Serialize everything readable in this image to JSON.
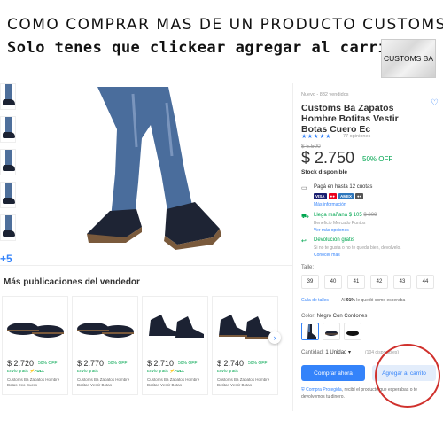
{
  "header": {
    "line1": "COMO COMPRAR MAS DE UN PRODUCTO CUSTOMS",
    "line2": "Solo tenes que clickear agregar al carrito",
    "logo_text": "CUSTOMS BA"
  },
  "gallery": {
    "more_label": "+5"
  },
  "seller_section": {
    "title": "Más publicaciones del vendedor",
    "cards": [
      {
        "price": "$ 2.720",
        "off": "50% OFF",
        "ship": "Envío gratis",
        "full": "⚡FULL",
        "title": "Customs Ba Zapatos Hombre Botas Eco Cuero"
      },
      {
        "price": "$ 2.770",
        "off": "50% OFF",
        "ship": "Envío gratis",
        "full": "",
        "title": "Customs Ba Zapatos Hombre Botitas Vestir Botas"
      },
      {
        "price": "$ 2.710",
        "off": "50% OFF",
        "ship": "Envío gratis",
        "full": "⚡FULL",
        "title": "Customs Ba Zapatos Hombre Botitas Vestir Botas"
      },
      {
        "price": "$ 2.740",
        "off": "50% OFF",
        "ship": "Envío gratis",
        "full": "",
        "title": "Customs Ba Zapatos Hombre Botitas Vestir Botas"
      }
    ]
  },
  "product": {
    "condition": "Nuevo  -  832 vendidos",
    "title": "Customs Ba Zapatos Hombre Botitas Vestir Botas Cuero Ec",
    "stars": "★★★★★",
    "reviews": "77 opiniones",
    "old_price": "$ 5.500",
    "price": "$ 2.750",
    "discount": "50% OFF",
    "stock": "Stock disponible",
    "payment": {
      "title": "Pagá en hasta 12 cuotas",
      "more": "Más información",
      "cards": [
        "VISA",
        "●●",
        "AMEX",
        "●●"
      ]
    },
    "shipping": {
      "title": "Llega mañana $ 105",
      "old": "$ 209",
      "sub": "Beneficio Mercado Puntos",
      "more": "Ver más opciones"
    },
    "returns": {
      "title": "Devolución gratis",
      "sub": "Si no te gusta o no te queda bien, devolvelo.",
      "more": "Conocer más"
    },
    "sizes_label": "Talle:",
    "sizes": [
      "39",
      "40",
      "41",
      "42",
      "43",
      "44"
    ],
    "size_guide": "Guía de talles",
    "size_note_pre": "Al ",
    "size_note_pct": "91%",
    "size_note_post": " le quedó como esperaba",
    "color_label": "Color: ",
    "color_value": "Negro Con Cordones",
    "qty_label": "Cantidad: ",
    "qty_value": "1 Unidad ▾",
    "qty_available": "(104 disponibles)",
    "buy_now": "Comprar ahora",
    "add_to_cart": "Agregar al carrito",
    "protect_pre": "",
    "protect_link": "Compra Protegida",
    "protect_post": ", recibí el producto que esperabas o te devolvemos tu dinero."
  },
  "colors": {
    "accent": "#3483fa",
    "green": "#00a650",
    "annotation": "#d0312d"
  }
}
